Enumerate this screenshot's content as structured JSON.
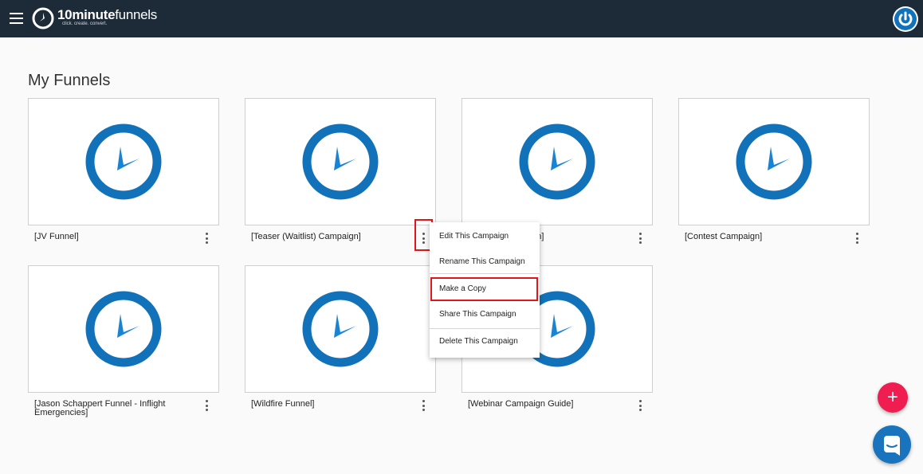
{
  "header": {
    "menu_icon": "hamburger-icon",
    "logo": {
      "brand_number": "10",
      "brand_word1": "minute",
      "brand_word2": "funnels",
      "tagline": "click. create. convert."
    },
    "power_icon": "power-icon"
  },
  "main": {
    "title": "My Funnels",
    "funnels": [
      {
        "name": "[JV Funnel]"
      },
      {
        "name": "[Teaser (Waitlist) Campaign]"
      },
      {
        "name": "[Launch Campaign]"
      },
      {
        "name": "[Contest Campaign]"
      },
      {
        "name": "[Jason Schappert Funnel - Inflight Emergencies]"
      },
      {
        "name": "[Wildfire Funnel]"
      },
      {
        "name": "[Webinar Campaign Guide]"
      }
    ],
    "thumbnail_icon": "clock-icon",
    "more_icon": "more-vert-icon"
  },
  "context_menu": {
    "items": [
      {
        "label": "Edit This Campaign"
      },
      {
        "label": "Rename This Campaign"
      },
      {
        "label": "Make a Copy"
      },
      {
        "label": "Share This Campaign"
      },
      {
        "label": "Delete This Campaign"
      }
    ]
  },
  "fab": {
    "label": "+"
  },
  "chat_icon": "chat-icon",
  "colors": {
    "topbar": "#1d2a38",
    "clock_blue": "#1172ba",
    "fab": "#f01d50",
    "highlight": "#e0161a"
  }
}
